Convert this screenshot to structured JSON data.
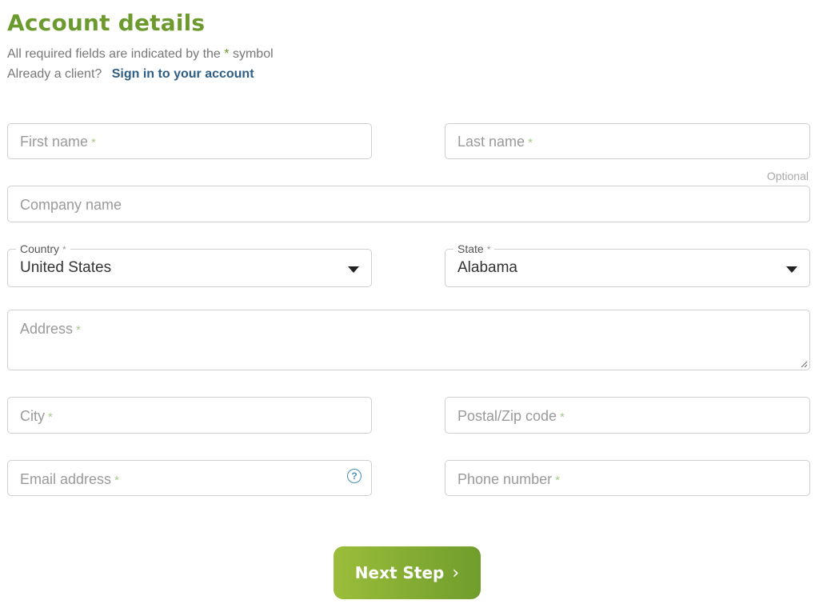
{
  "header": {
    "title": "Account details",
    "required_prefix": "All required fields are indicated by the",
    "required_star": "*",
    "required_suffix": "symbol",
    "already_client": "Already a client?",
    "signin_link": "Sign in to your account"
  },
  "form": {
    "first_name": {
      "placeholder": "First name",
      "required": "*"
    },
    "last_name": {
      "placeholder": "Last name",
      "required": "*"
    },
    "optional_label": "Optional",
    "company_name": {
      "placeholder": "Company name"
    },
    "country": {
      "label": "Country",
      "required": "*",
      "value": "United States"
    },
    "state": {
      "label": "State",
      "required": "*",
      "value": "Alabama"
    },
    "address": {
      "placeholder": "Address",
      "required": "*"
    },
    "city": {
      "placeholder": "City",
      "required": "*"
    },
    "postal": {
      "placeholder": "Postal/Zip code",
      "required": "*"
    },
    "email": {
      "placeholder": "Email address",
      "required": "*",
      "help_icon": "question-circle-icon",
      "help_glyph": "?"
    },
    "phone": {
      "placeholder": "Phone number",
      "required": "*"
    }
  },
  "actions": {
    "next_label": "Next Step",
    "next_icon": "chevron-right-icon",
    "next_glyph": "›"
  },
  "colors": {
    "accent_green": "#6c9a2e",
    "link_blue": "#2e5d85",
    "help_blue": "#4a90b8"
  }
}
